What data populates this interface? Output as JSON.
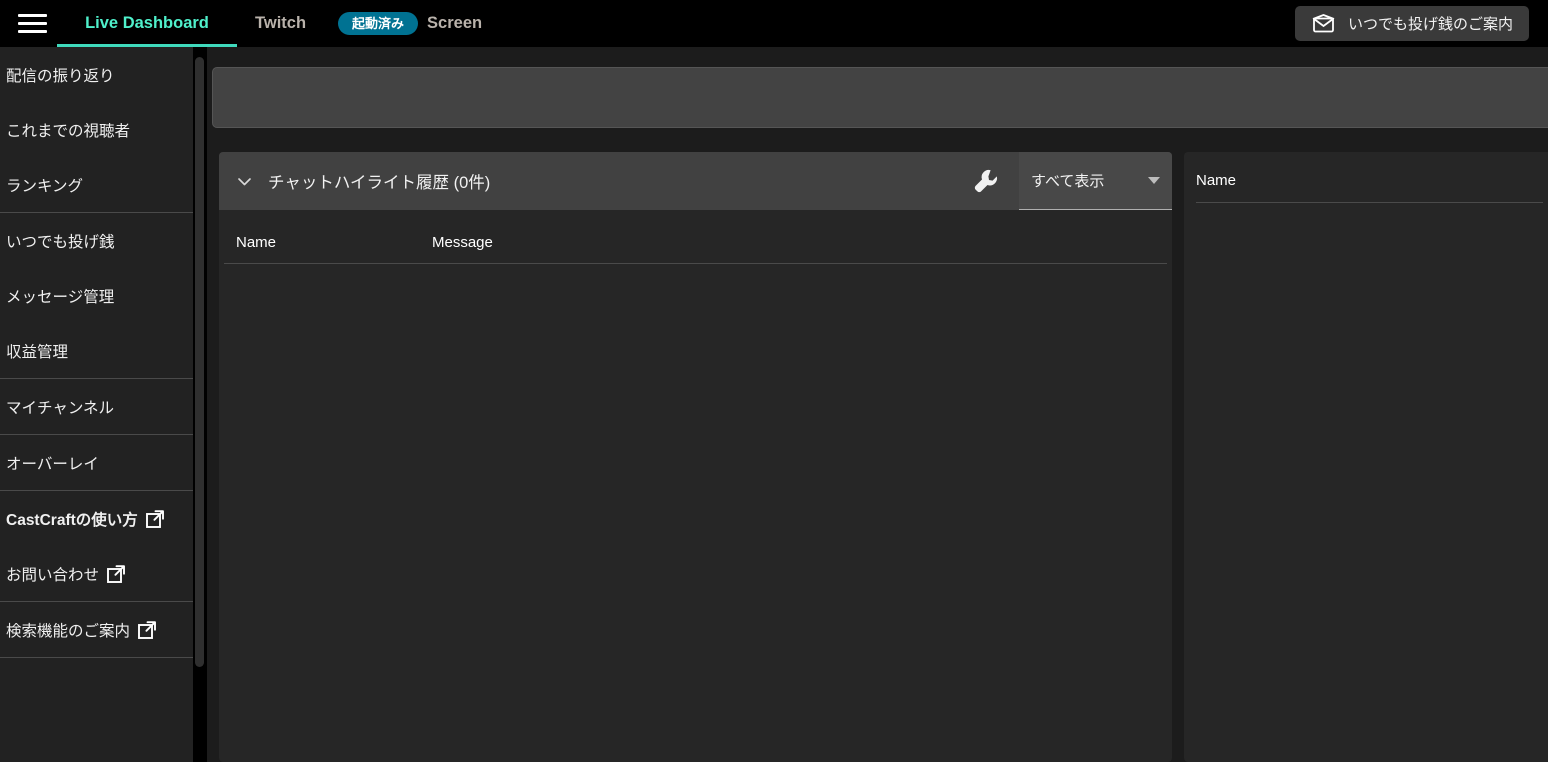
{
  "topbar": {
    "menu_icon": "hamburger-icon",
    "tabs": [
      {
        "label": "Live Dashboard",
        "active": true
      },
      {
        "label": "Twitch",
        "active": false
      }
    ],
    "screen": {
      "status_badge": "起動済み",
      "label": "Screen"
    },
    "donate_button": {
      "icon": "mail-icon",
      "label": "いつでも投げ銭のご案内"
    },
    "accent_color": "#4ff0cb",
    "badge_color": "#007292"
  },
  "sidebar": {
    "groups": [
      {
        "items": [
          {
            "label": "配信の振り返り",
            "external": false,
            "bold": false
          },
          {
            "label": "これまでの視聴者",
            "external": false,
            "bold": false
          },
          {
            "label": "ランキング",
            "external": false,
            "bold": false
          }
        ]
      },
      {
        "items": [
          {
            "label": "いつでも投げ銭",
            "external": false,
            "bold": false
          },
          {
            "label": "メッセージ管理",
            "external": false,
            "bold": false
          },
          {
            "label": "収益管理",
            "external": false,
            "bold": false
          }
        ]
      },
      {
        "items": [
          {
            "label": "マイチャンネル",
            "external": false,
            "bold": false
          }
        ]
      },
      {
        "items": [
          {
            "label": "オーバーレイ",
            "external": false,
            "bold": false
          }
        ]
      },
      {
        "items": [
          {
            "label": "CastCraftの使い方",
            "external": true,
            "bold": true
          },
          {
            "label": "お問い合わせ",
            "external": true,
            "bold": false
          }
        ]
      },
      {
        "items": [
          {
            "label": "検索機能のご案内",
            "external": true,
            "bold": false
          }
        ]
      }
    ]
  },
  "main": {
    "chat_card": {
      "collapse_icon": "chevron-down-icon",
      "title": "チャットハイライト履歴 (0件)",
      "settings_icon": "wrench-icon",
      "filter_select": {
        "selected": "すべて表示",
        "options": [
          "すべて表示"
        ]
      },
      "table": {
        "columns": [
          "Name",
          "Message"
        ],
        "rows": []
      }
    },
    "name_card": {
      "table": {
        "columns": [
          "Name"
        ],
        "rows": []
      }
    }
  }
}
